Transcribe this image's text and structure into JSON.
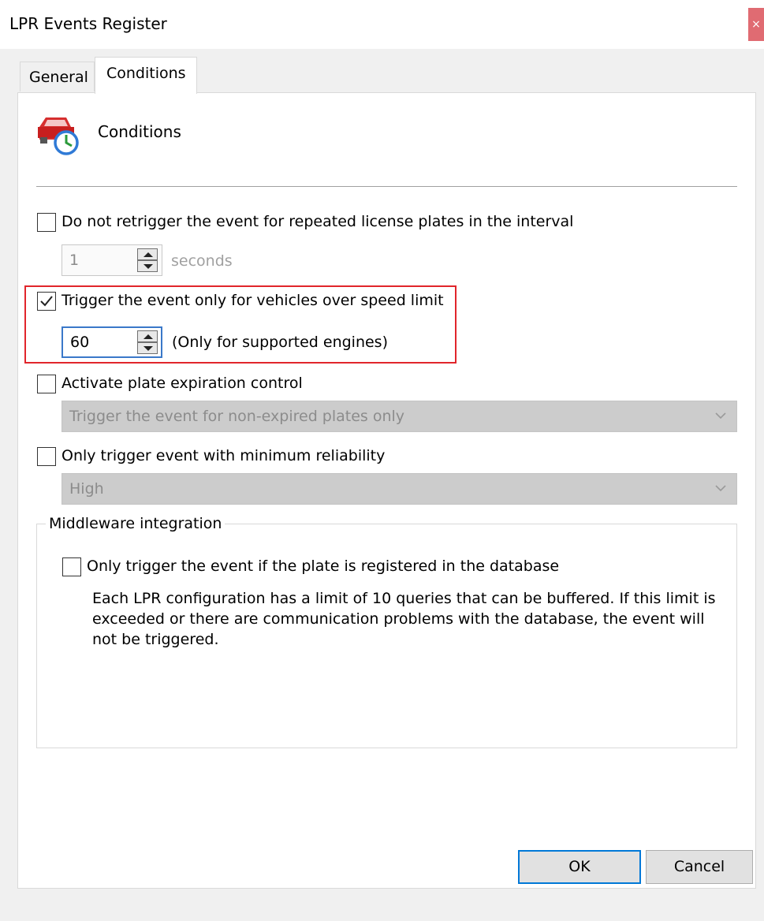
{
  "window": {
    "title": "LPR Events Register",
    "close_label": "×"
  },
  "tabs": [
    {
      "label": "General",
      "selected": false
    },
    {
      "label": "Conditions",
      "selected": true
    }
  ],
  "header": {
    "title": "Conditions",
    "icon": "car-clock-icon"
  },
  "retrigger": {
    "label": "Do not retrigger the event for repeated license plates in the interval",
    "checked": false,
    "value": "1",
    "unit": "seconds"
  },
  "speed": {
    "label": "Trigger the event only for vehicles over speed limit",
    "checked": true,
    "value": "60",
    "note": "(Only for supported engines)"
  },
  "expiration": {
    "label": "Activate plate expiration control",
    "checked": false,
    "selected": "Trigger the event for non-expired plates only"
  },
  "reliability": {
    "label": "Only trigger event with minimum reliability",
    "checked": false,
    "selected": "High"
  },
  "middleware": {
    "title": "Middleware integration",
    "label": "Only trigger the event if the plate is registered in the database",
    "checked": false,
    "description": "Each LPR configuration has a limit of 10 queries that can be buffered. If this limit is exceeded or there are communication problems with the database, the event will not be triggered."
  },
  "buttons": {
    "ok": "OK",
    "cancel": "Cancel"
  },
  "colors": {
    "highlight": "#e1252b",
    "accent": "#0078d7",
    "close": "#e06b72"
  }
}
